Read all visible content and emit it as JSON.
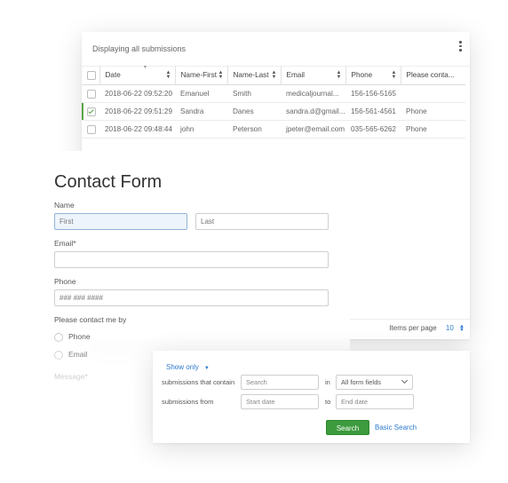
{
  "submissions": {
    "title": "Displaying all submissions",
    "columns": [
      "Date",
      "Name-First",
      "Name-Last",
      "Email",
      "Phone",
      "Please conta..."
    ],
    "rows": [
      {
        "checked": false,
        "cells": [
          "2018-06-22 09:52:20",
          "Emanuel",
          "Smith",
          "medicaljournal...",
          "156-156-5165",
          ""
        ]
      },
      {
        "checked": true,
        "cells": [
          "2018-06-22 09:51:29",
          "Sandra",
          "Danes",
          "sandra.d@gmail...",
          "156-561-4561",
          "Phone"
        ]
      },
      {
        "checked": false,
        "cells": [
          "2018-06-22 09:48:44",
          "john",
          "Peterson",
          "jpeter@email.com",
          "035-565-6262",
          "Phone"
        ]
      }
    ],
    "pager": {
      "label": "Items per page",
      "value": "10"
    }
  },
  "contact_form": {
    "heading": "Contact Form",
    "name_label": "Name",
    "first_placeholder": "First",
    "last_placeholder": "Last",
    "email_label": "Email*",
    "phone_label": "Phone",
    "phone_placeholder": "### ### ####",
    "contact_by_label": "Please contact me by",
    "options": [
      "Phone",
      "Email"
    ],
    "message_label": "Message*"
  },
  "search": {
    "show_only": "Show only",
    "contain_label": "submissions that contain",
    "search_placeholder": "Search",
    "in_label": "in",
    "field_select": "All form fields",
    "from_label": "submissions from",
    "start_placeholder": "Start date",
    "to_label": "to",
    "end_placeholder": "End date",
    "search_button": "Search",
    "basic_link": "Basic Search"
  },
  "colors": {
    "accent_green": "#3d9a3d",
    "link_blue": "#2e7bcf"
  }
}
